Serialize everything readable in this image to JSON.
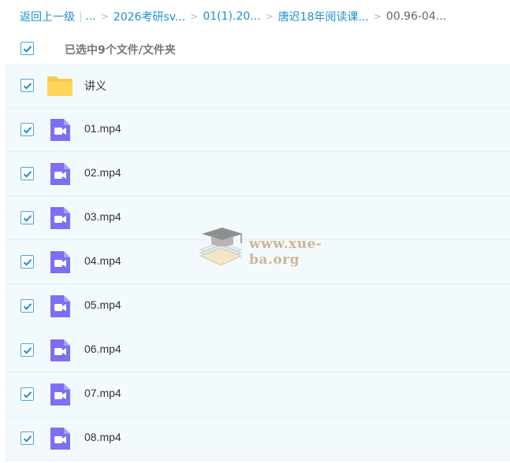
{
  "breadcrumb": {
    "back": "返回上一级",
    "ellipsis": "...",
    "items": [
      "2026考研sv...",
      "01(1).20...",
      "唐迟18年阅读课..."
    ],
    "current": "00.96-04..."
  },
  "selection": {
    "label": "已选中9个文件/文件夹",
    "all_checked": true
  },
  "files": [
    {
      "name": "讲义",
      "type": "folder",
      "icon": "folder-icon",
      "checked": true
    },
    {
      "name": "01.mp4",
      "type": "video",
      "icon": "video-icon",
      "checked": true
    },
    {
      "name": "02.mp4",
      "type": "video",
      "icon": "video-icon",
      "checked": true
    },
    {
      "name": "03.mp4",
      "type": "video",
      "icon": "video-icon",
      "checked": true
    },
    {
      "name": "04.mp4",
      "type": "video",
      "icon": "video-icon",
      "checked": true
    },
    {
      "name": "05.mp4",
      "type": "video",
      "icon": "video-icon",
      "checked": true
    },
    {
      "name": "06.mp4",
      "type": "video",
      "icon": "video-icon",
      "checked": true
    },
    {
      "name": "07.mp4",
      "type": "video",
      "icon": "video-icon",
      "checked": true
    },
    {
      "name": "08.mp4",
      "type": "video",
      "icon": "video-icon",
      "checked": true
    }
  ],
  "watermark": {
    "text": "www.xue-ba.org",
    "icon": "graduation-cap-books-logo"
  },
  "colors": {
    "link": "#1f8fcf",
    "checkbox": "#4aa3df",
    "row_bg": "#f3fafe",
    "folder": "#ffd659",
    "video": "#7c6ff2"
  }
}
